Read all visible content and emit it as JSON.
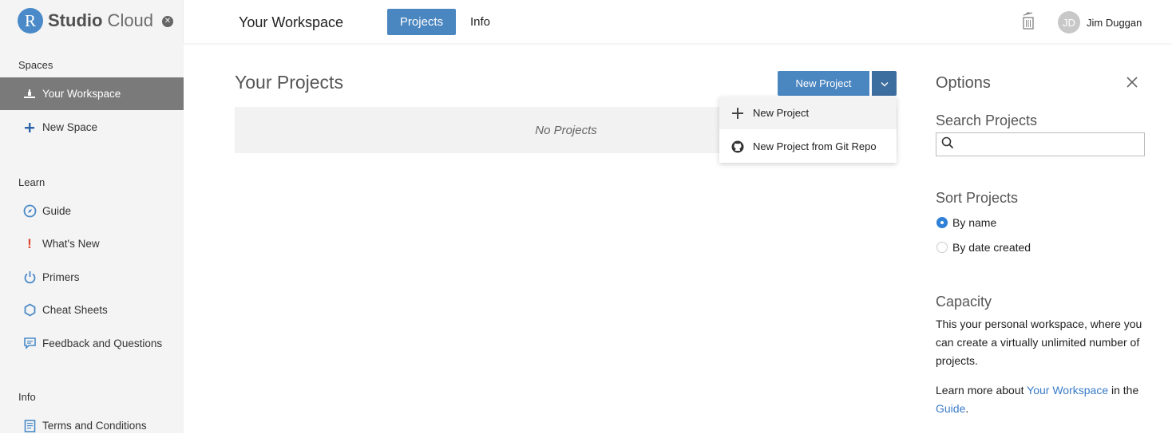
{
  "brand": {
    "logo_letter": "R",
    "name_bold": "Studio",
    "name_light": " Cloud"
  },
  "sidebar": {
    "spaces_label": "Spaces",
    "spaces": [
      {
        "label": "Your Workspace",
        "icon": "workspace-icon",
        "active": true
      },
      {
        "label": "New Space",
        "icon": "plus-icon",
        "active": false
      }
    ],
    "learn_label": "Learn",
    "learn": [
      {
        "label": "Guide",
        "icon": "compass-icon"
      },
      {
        "label": "What's New",
        "icon": "exclamation-icon"
      },
      {
        "label": "Primers",
        "icon": "power-icon"
      },
      {
        "label": "Cheat Sheets",
        "icon": "hexagon-icon"
      },
      {
        "label": "Feedback and Questions",
        "icon": "chat-icon"
      }
    ],
    "info_label": "Info",
    "info": [
      {
        "label": "Terms and Conditions",
        "icon": "document-icon"
      }
    ]
  },
  "header": {
    "workspace_title": "Your Workspace",
    "tabs": [
      {
        "label": "Projects",
        "active": true
      },
      {
        "label": "Info",
        "active": false
      }
    ],
    "user": {
      "initials": "JD",
      "name": "Jim Duggan"
    }
  },
  "main": {
    "title": "Your Projects",
    "empty_message": "No Projects",
    "new_project_label": "New Project",
    "menu": [
      {
        "label": "New Project",
        "icon": "plus-icon"
      },
      {
        "label": "New Project from Git Repo",
        "icon": "github-icon"
      }
    ]
  },
  "options": {
    "title": "Options",
    "search_heading": "Search Projects",
    "search_value": "",
    "sort_heading": "Sort Projects",
    "sort_options": [
      {
        "label": "By name",
        "selected": true
      },
      {
        "label": "By date created",
        "selected": false
      }
    ],
    "capacity_heading": "Capacity",
    "capacity_text": "This your personal workspace, where you can create a virtually unlimited number of projects.",
    "learn_prefix": "Learn more about ",
    "learn_link": "Your Workspace",
    "learn_middle": " in the ",
    "learn_link2": "Guide",
    "learn_suffix": "."
  },
  "colors": {
    "accent": "#4a86c0",
    "accent_dark": "#3d6ea0",
    "sidebar_active": "#7a7a7a",
    "link": "#3a7bc8"
  }
}
